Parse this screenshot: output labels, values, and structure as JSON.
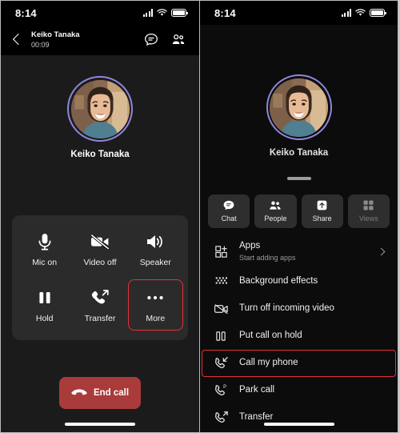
{
  "colors": {
    "accent_highlight": "#e8303a",
    "end_call_bg": "#a93b3b",
    "avatar_ring": "#8f86e0",
    "panel_bg": "#2b2b2b",
    "page_bg": "#1b1b1b",
    "sheet_bg": "#0c0c0c"
  },
  "left_phone": {
    "status_bar": {
      "time": "8:14",
      "icons": [
        "signal-bars-icon",
        "wifi-icon",
        "battery-icon"
      ]
    },
    "call_header": {
      "back_icon": "back-chevron-icon",
      "contact_name": "Keiko Tanaka",
      "call_timer": "00:09",
      "actions": [
        {
          "name": "chat-icon",
          "label": "Chat"
        },
        {
          "name": "people-icon",
          "label": "People"
        }
      ]
    },
    "avatar": {
      "name": "Keiko Tanaka",
      "icon": "avatar"
    },
    "controls": [
      {
        "label": "Mic on",
        "icon": "microphone-icon",
        "highlighted": false
      },
      {
        "label": "Video off",
        "icon": "video-off-icon",
        "highlighted": false
      },
      {
        "label": "Speaker",
        "icon": "speaker-icon",
        "highlighted": false
      },
      {
        "label": "Hold",
        "icon": "pause-icon",
        "highlighted": false
      },
      {
        "label": "Transfer",
        "icon": "phone-transfer-icon",
        "highlighted": false
      },
      {
        "label": "More",
        "icon": "more-dots-icon",
        "highlighted": true
      }
    ],
    "end_call": {
      "label": "End call",
      "icon": "phone-hangup-icon"
    }
  },
  "right_phone": {
    "status_bar": {
      "time": "8:14",
      "icons": [
        "signal-bars-icon",
        "wifi-icon",
        "battery-icon"
      ]
    },
    "avatar": {
      "name": "Keiko Tanaka",
      "icon": "avatar"
    },
    "sheet": {
      "drag_handle": "drag-handle",
      "tabs": [
        {
          "label": "Chat",
          "icon": "chat-icon",
          "disabled": false
        },
        {
          "label": "People",
          "icon": "people-icon",
          "disabled": false
        },
        {
          "label": "Share",
          "icon": "share-icon",
          "disabled": false
        },
        {
          "label": "Views",
          "icon": "grid-icon",
          "disabled": true
        }
      ],
      "menu": [
        {
          "title": "Apps",
          "subtitle": "Start adding apps",
          "icon": "apps-grid-icon",
          "chevron": true,
          "highlighted": false
        },
        {
          "title": "Background effects",
          "subtitle": "",
          "icon": "background-effects-icon",
          "chevron": false,
          "highlighted": false
        },
        {
          "title": "Turn off incoming video",
          "subtitle": "",
          "icon": "video-off-icon",
          "chevron": false,
          "highlighted": false
        },
        {
          "title": "Put call on hold",
          "subtitle": "",
          "icon": "pause-icon",
          "chevron": false,
          "highlighted": false
        },
        {
          "title": "Call my phone",
          "subtitle": "",
          "icon": "phone-incoming-icon",
          "chevron": false,
          "highlighted": true
        },
        {
          "title": "Park call",
          "subtitle": "",
          "icon": "phone-park-icon",
          "chevron": false,
          "highlighted": false
        },
        {
          "title": "Transfer",
          "subtitle": "",
          "icon": "phone-transfer-icon",
          "chevron": false,
          "highlighted": false
        }
      ]
    }
  }
}
